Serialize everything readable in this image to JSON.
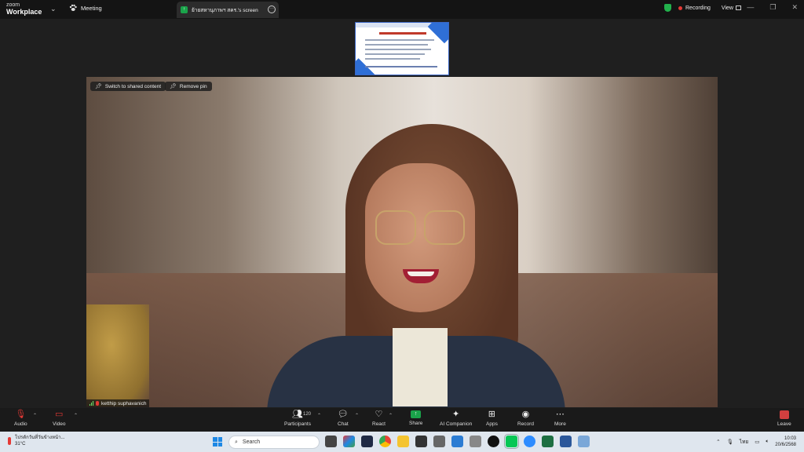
{
  "titlebar": {
    "logo_top": "zoom",
    "logo_bottom": "Workplace",
    "meeting_label": "Meeting",
    "share_tab_label": "ย้ายสหานุภาพฯ สคร.'s screen",
    "share_tab_icon": "green-share-icon",
    "recording_label": "Recording",
    "view_label": "View",
    "window_controls": [
      "—",
      "❐",
      "✕"
    ]
  },
  "video": {
    "switch_label": "Switch to shared content",
    "remove_pin_label": "Remove pin",
    "participant_name": "ketthip suphavanich"
  },
  "toolbar": {
    "audio": "Audio",
    "video": "Video",
    "participants": "Participants",
    "participants_count": "120",
    "chat": "Chat",
    "react": "React",
    "share": "Share",
    "ai_companion": "AI Companion",
    "apps": "Apps",
    "record": "Record",
    "more": "More",
    "leave": "Leave"
  },
  "taskbar": {
    "weather_text": "โปรดักวันที่วันข้างหน้า...",
    "temperature": "31°C",
    "search_placeholder": "Search",
    "language": "ไทย",
    "time": "10:03",
    "date": "20/6/2568"
  },
  "colors": {
    "accent_green": "#1aa34a",
    "record_red": "#e53935",
    "toolbar_bg": "#1a1a1a",
    "taskbar_bg": "#dfe6ee"
  }
}
